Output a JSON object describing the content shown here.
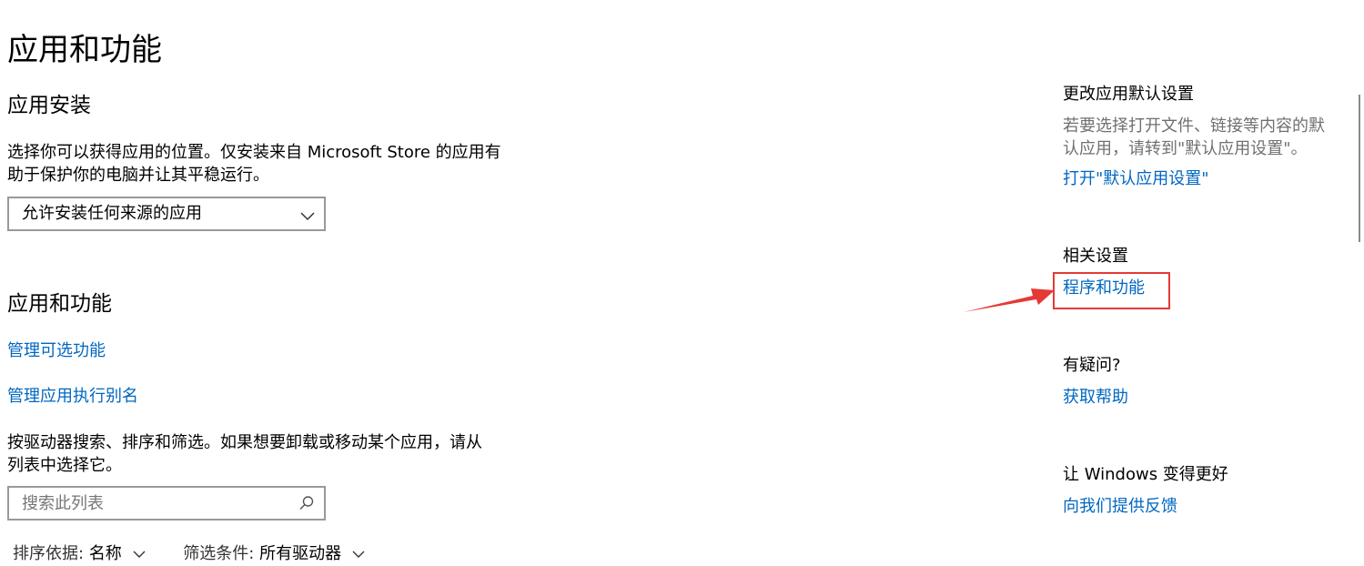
{
  "page": {
    "title": "应用和功能"
  },
  "install": {
    "heading": "应用安装",
    "description_line1": "选择你可以获得应用的位置。仅安装来自 Microsoft Store 的应用有",
    "description_line2": "助于保护你的电脑并让其平稳运行。",
    "source_selected": "允许安装任何来源的应用"
  },
  "apps": {
    "heading": "应用和功能",
    "manage_optional_label": "管理可选功能",
    "manage_aliases_label": "管理应用执行别名",
    "search_help_line1": "按驱动器搜索、排序和筛选。如果想要卸载或移动某个应用，请从",
    "search_help_line2": "列表中选择它。",
    "search_placeholder": "搜索此列表",
    "sort_key": "排序依据:",
    "sort_value": "名称",
    "filter_key": "筛选条件:",
    "filter_value": "所有驱动器"
  },
  "sidebar": {
    "defaults_heading": "更改应用默认设置",
    "defaults_desc_line1": "若要选择打开文件、链接等内容的默",
    "defaults_desc_line2": "认应用，请转到\"默认应用设置\"。",
    "defaults_link": "打开\"默认应用设置\"",
    "related_heading": "相关设置",
    "programs_link": "程序和功能",
    "question_heading": "有疑问?",
    "help_link": "获取帮助",
    "improve_heading": "让 Windows 变得更好",
    "feedback_link": "向我们提供反馈"
  },
  "icons": {
    "dropdown": "chevron-down-icon",
    "search": "search-icon",
    "annotation": "red-arrow-icon"
  },
  "colors": {
    "link": "#0067c0",
    "annotation": "#e53935"
  }
}
